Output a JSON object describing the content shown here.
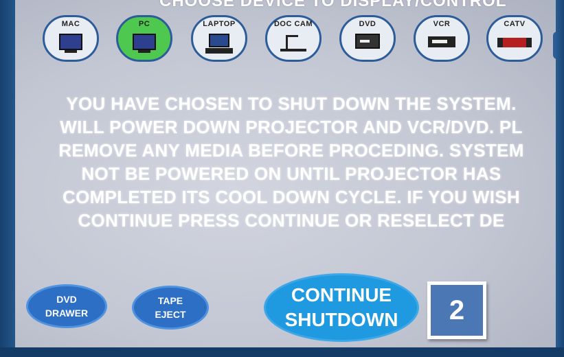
{
  "header": {
    "title": "CHOOSE DEVICE TO DISPLAY/CONTROL"
  },
  "devices": [
    {
      "label": "MAC",
      "icon": "mac-monitor-icon",
      "selected": false
    },
    {
      "label": "PC",
      "icon": "pc-monitor-icon",
      "selected": true
    },
    {
      "label": "LAPTOP",
      "icon": "laptop-icon",
      "selected": false
    },
    {
      "label": "DOC CAM",
      "icon": "document-camera-icon",
      "selected": false
    },
    {
      "label": "DVD",
      "icon": "dvd-player-icon",
      "selected": false
    },
    {
      "label": "VCR",
      "icon": "vcr-icon",
      "selected": false
    },
    {
      "label": "CATV",
      "icon": "catv-connector-icon",
      "selected": false
    }
  ],
  "message": {
    "lines": [
      "YOU HAVE CHOSEN TO SHUT DOWN THE SYSTEM.",
      "WILL POWER DOWN PROJECTOR AND VCR/DVD. PL",
      "REMOVE ANY MEDIA BEFORE PROCEDING. SYSTEM",
      "NOT BE POWERED ON UNTIL PROJECTOR HAS",
      "COMPLETED ITS COOL DOWN CYCLE. IF YOU WISH",
      "CONTINUE PRESS CONTINUE OR RESELECT DE"
    ]
  },
  "buttons": {
    "dvd_drawer": [
      "DVD",
      "DRAWER"
    ],
    "tape_eject": [
      "TAPE",
      "EJECT"
    ],
    "continue_shutdown": [
      "CONTINUE",
      "SHUTDOWN"
    ]
  },
  "badge": {
    "value": "2"
  },
  "colors": {
    "selected_device": "#4ec84e",
    "button_blue": "#2d6fc4",
    "continue_blue": "#1f9ae0",
    "badge_blue": "#4b77b5"
  }
}
